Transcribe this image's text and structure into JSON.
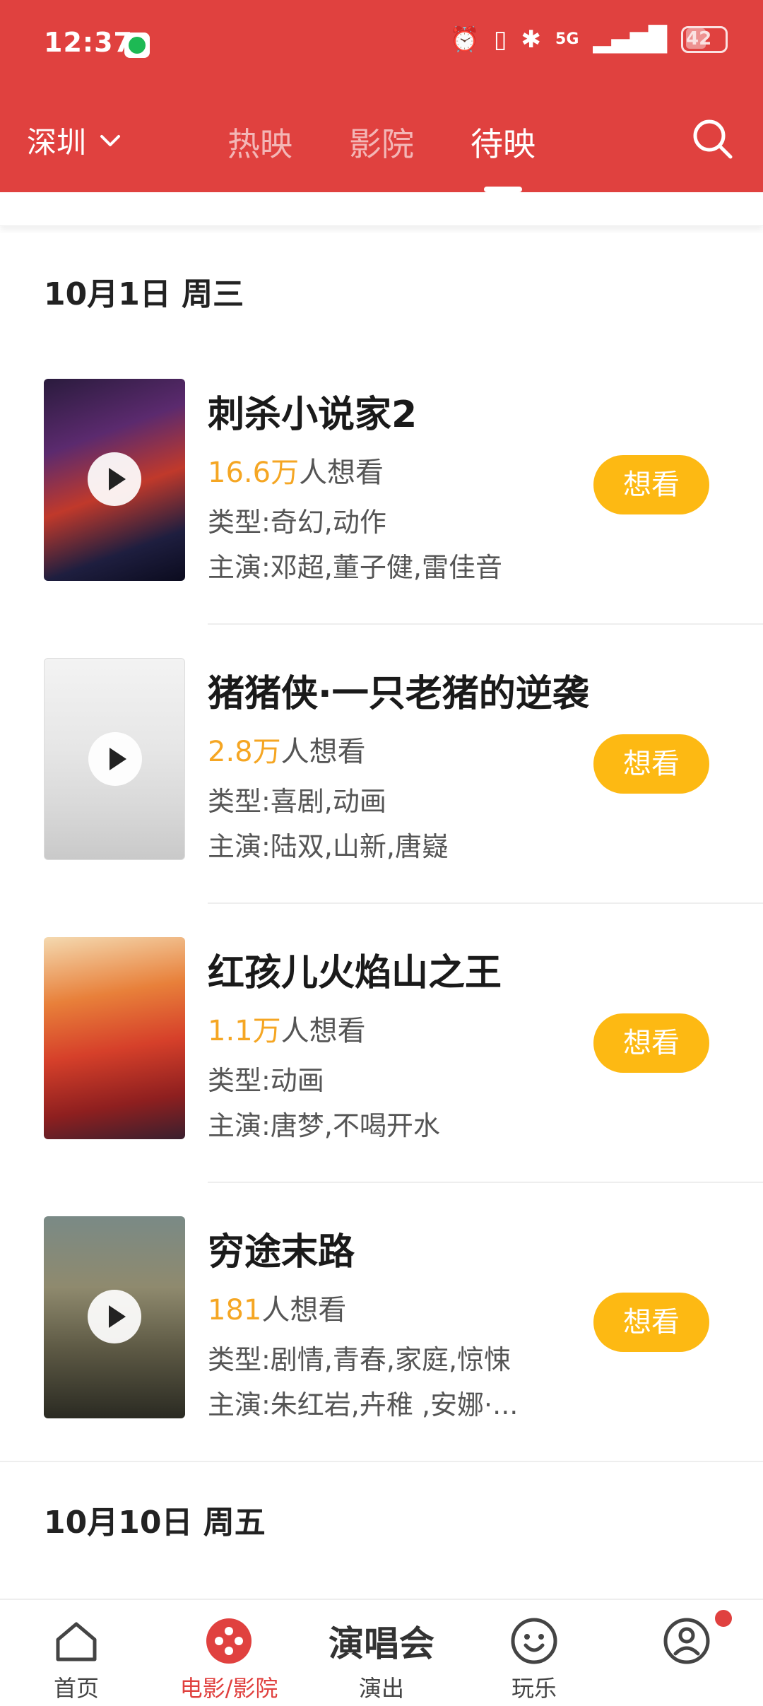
{
  "status_bar": {
    "time": "12:37",
    "battery": "42",
    "network": "5G"
  },
  "nav": {
    "city": "深圳",
    "tabs": [
      {
        "label": "热映",
        "active": false
      },
      {
        "label": "影院",
        "active": false
      },
      {
        "label": "待映",
        "active": true
      }
    ]
  },
  "sections": [
    {
      "date": "10月1日 周三"
    },
    {
      "date": "10月10日 周五"
    }
  ],
  "movies": [
    {
      "title": "刺杀小说家2",
      "want_count": "16.6万",
      "want_suffix": "人想看",
      "genre": "类型:奇幻,动作",
      "cast": "主演:邓超,董子健,雷佳音",
      "button": "想看"
    },
    {
      "title": "猪猪侠·一只老猪的逆袭",
      "want_count": "2.8万",
      "want_suffix": "人想看",
      "genre": "类型:喜剧,动画",
      "cast": "主演:陆双,山新,唐嶷",
      "button": "想看"
    },
    {
      "title": "红孩儿火焰山之王",
      "want_count": "1.1万",
      "want_suffix": "人想看",
      "genre": "类型:动画",
      "cast": "主演:唐梦,不喝开水",
      "button": "想看"
    },
    {
      "title": "穷途末路",
      "want_count": "181",
      "want_suffix": "人想看",
      "genre": "类型:剧情,青春,家庭,惊悚",
      "cast": "主演:朱红岩,卉稚 ,安娜·...",
      "button": "想看"
    }
  ],
  "bottom_nav": {
    "items": [
      {
        "label": "首页",
        "icon": "home-icon"
      },
      {
        "label": "电影/影院",
        "icon": "film-reel-icon",
        "active": true
      },
      {
        "label": "演出",
        "big_label": "演唱会"
      },
      {
        "label": "玩乐",
        "icon": "smile-icon"
      },
      {
        "label": "",
        "icon": "profile-icon",
        "has_dot": true
      }
    ]
  },
  "colors": {
    "header_red": "#e0413f",
    "want_button": "#fdb913",
    "want_count": "#f5a623"
  }
}
